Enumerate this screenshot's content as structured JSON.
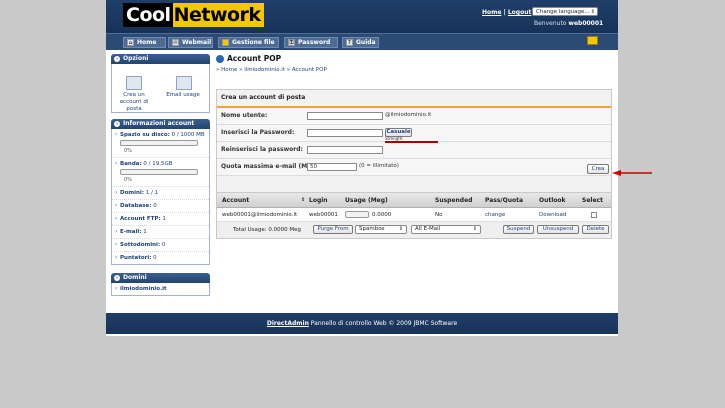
{
  "header": {
    "logo_part1": "Cool",
    "logo_part2": "Network",
    "home_link": "Home",
    "separator": "|",
    "logout_link": "Logout",
    "language_select": "Change language...",
    "welcome_prefix": "Benvenuto",
    "username": "web00001"
  },
  "nav": {
    "items": [
      {
        "label": "Home",
        "icon": "home-icon"
      },
      {
        "label": "Webmail",
        "icon": "mail-icon"
      },
      {
        "label": "Gestione file",
        "icon": "folder-icon"
      },
      {
        "label": "Password",
        "icon": "key-icon"
      },
      {
        "label": "Guida",
        "icon": "help-icon"
      }
    ]
  },
  "sidebar": {
    "options_title": "Opzioni",
    "create_account_label": "Crea un account di posta",
    "email_usage_label": "Email usage",
    "info_title": "Informazioni account",
    "disk_label": "Spazio su disco:",
    "disk_value": "0 / 1000 MB",
    "disk_pct": "0%",
    "band_label": "Banda:",
    "band_value": "0 / 19.5GB",
    "band_pct": "0%",
    "domains_label": "Domini:",
    "domains_value": "1 / 1",
    "db_label": "Database:",
    "db_value": "0",
    "ftp_label": "Account FTP:",
    "ftp_value": "1",
    "email_label": "E-mail:",
    "email_value": "1",
    "subdomains_label": "Sottodomini:",
    "subdomains_value": "0",
    "pointers_label": "Puntatori:",
    "pointers_value": "0",
    "domains_title": "Domini",
    "domain_item": "ilmiodominio.it"
  },
  "main": {
    "title": "Account POP",
    "breadcrumb": "» Home » ilmiodominio.it » Account POP",
    "form": {
      "title": "Crea un account di posta",
      "username_label": "Nome utente:",
      "username_value": "",
      "domain_suffix": "@ilmiodominio.it",
      "password_label": "Inserisci la Password:",
      "password_value": "",
      "random_button": "Casuale",
      "repeat_label": "Reinserisci la password:",
      "repeat_value": "",
      "strength_label": "Strength:",
      "quota_label": "Quota massima e-mail (MB):",
      "quota_value": "50",
      "quota_hint": "(0 = illimitato)",
      "create_button": "Crea"
    },
    "table": {
      "headers": [
        "Account",
        "Login",
        "Usage (Meg)",
        "Suspended",
        "Pass/Quota",
        "Outlook",
        "Select"
      ],
      "sort_icon": "sort-arrows-icon",
      "row": {
        "account": "web00001@ilmiodominio.it",
        "login": "web00001",
        "usage": "0.0000",
        "suspended": "No",
        "pass_quota": "change",
        "outlook": "Download"
      },
      "total_usage": "Total Usage: 0.0000 Meg",
      "purge_button": "Purge From",
      "spambox_select": "Spambox",
      "all_email_select": "All E-Mail",
      "suspend_button": "Suspend",
      "unsuspend_button": "Unsuspend",
      "delete_button": "Delete"
    }
  },
  "footer": {
    "link": "DirectAdmin",
    "text": "Pannello di controllo Web © 2009 JBMC Software"
  },
  "colors": {
    "header_bg": "#1f3f69",
    "logo_yellow": "#f4c700",
    "annotation_arrow": "#cc0000"
  }
}
